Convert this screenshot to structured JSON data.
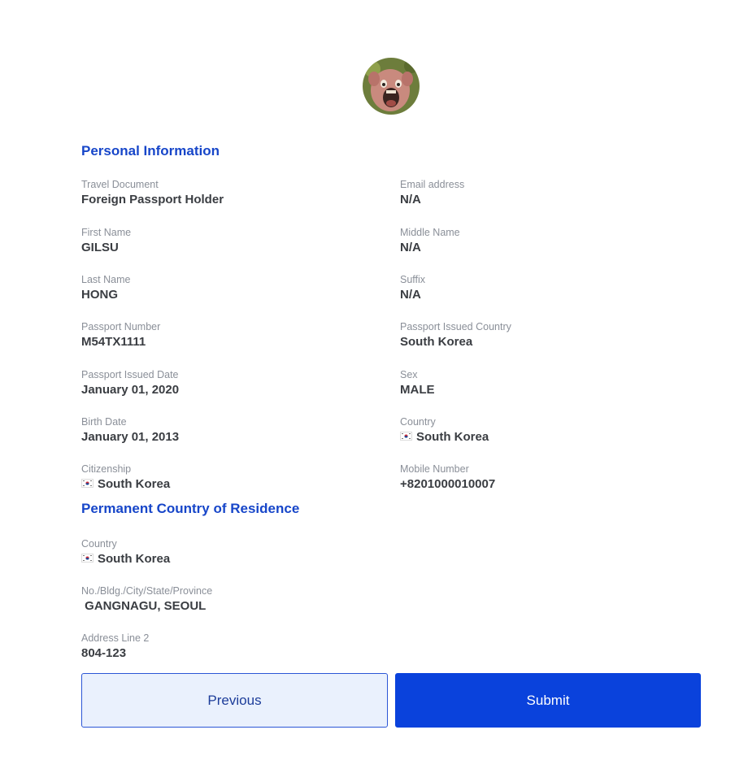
{
  "profile": {
    "avatar_icon": "user-avatar-photo"
  },
  "sections": {
    "personal_information": "Personal Information",
    "permanent_residence": "Permanent Country of Residence"
  },
  "personal": {
    "travel_document": {
      "label": "Travel Document",
      "value": "Foreign Passport Holder"
    },
    "email": {
      "label": "Email address",
      "value": "N/A"
    },
    "first_name": {
      "label": "First Name",
      "value": "GILSU"
    },
    "middle_name": {
      "label": "Middle Name",
      "value": "N/A"
    },
    "last_name": {
      "label": "Last Name",
      "value": "HONG"
    },
    "suffix": {
      "label": "Suffix",
      "value": "N/A"
    },
    "passport_number": {
      "label": "Passport Number",
      "value": "M54TX1111"
    },
    "passport_country": {
      "label": "Passport Issued Country",
      "value": "South Korea"
    },
    "passport_date": {
      "label": "Passport Issued Date",
      "value": "January 01, 2020"
    },
    "sex": {
      "label": "Sex",
      "value": "MALE"
    },
    "birth_date": {
      "label": "Birth Date",
      "value": "January 01, 2013"
    },
    "country": {
      "label": "Country",
      "value": "South Korea",
      "flag": "south-korea-flag"
    },
    "citizenship": {
      "label": "Citizenship",
      "value": "South Korea",
      "flag": "south-korea-flag"
    },
    "mobile": {
      "label": "Mobile Number",
      "value": "+8201000010007"
    }
  },
  "residence": {
    "country": {
      "label": "Country",
      "value": "South Korea",
      "flag": "south-korea-flag"
    },
    "address1": {
      "label": "No./Bldg./City/State/Province",
      "value": " GANGNAGU, SEOUL"
    },
    "address2": {
      "label": "Address Line 2",
      "value": "804-123"
    }
  },
  "actions": {
    "previous_label": "Previous",
    "submit_label": "Submit"
  },
  "colors": {
    "accent": "#1746c9",
    "submit_bg": "#0a42dc",
    "previous_bg": "#eaf1fd",
    "label_text": "#8a8f98",
    "value_text": "#3a3d42"
  }
}
